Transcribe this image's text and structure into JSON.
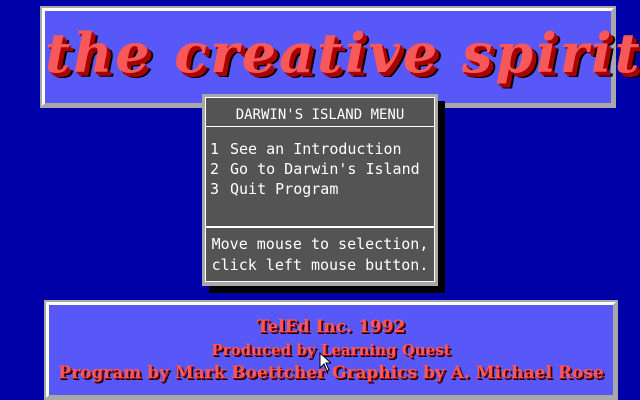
{
  "title": "the creative spirit",
  "menu": {
    "header": "DARWIN'S ISLAND MENU",
    "items": [
      {
        "number": "1",
        "label": "See an Introduction"
      },
      {
        "number": "2",
        "label": "Go to Darwin's Island"
      },
      {
        "number": "3",
        "label": "Quit Program"
      }
    ],
    "instructions": [
      "Move mouse to selection,",
      "click left mouse button."
    ]
  },
  "credits": [
    "TelEd Inc. 1992",
    "Produced by Learning Quest",
    "Program by Mark Boettcher   Graphics by A. Michael Rose"
  ],
  "colors": {
    "background": "#0000a8",
    "panel": "#5858f8",
    "title_red": "#f85858",
    "menu_gray": "#545454"
  },
  "icons": {
    "cursor": "arrow-cursor-icon"
  }
}
